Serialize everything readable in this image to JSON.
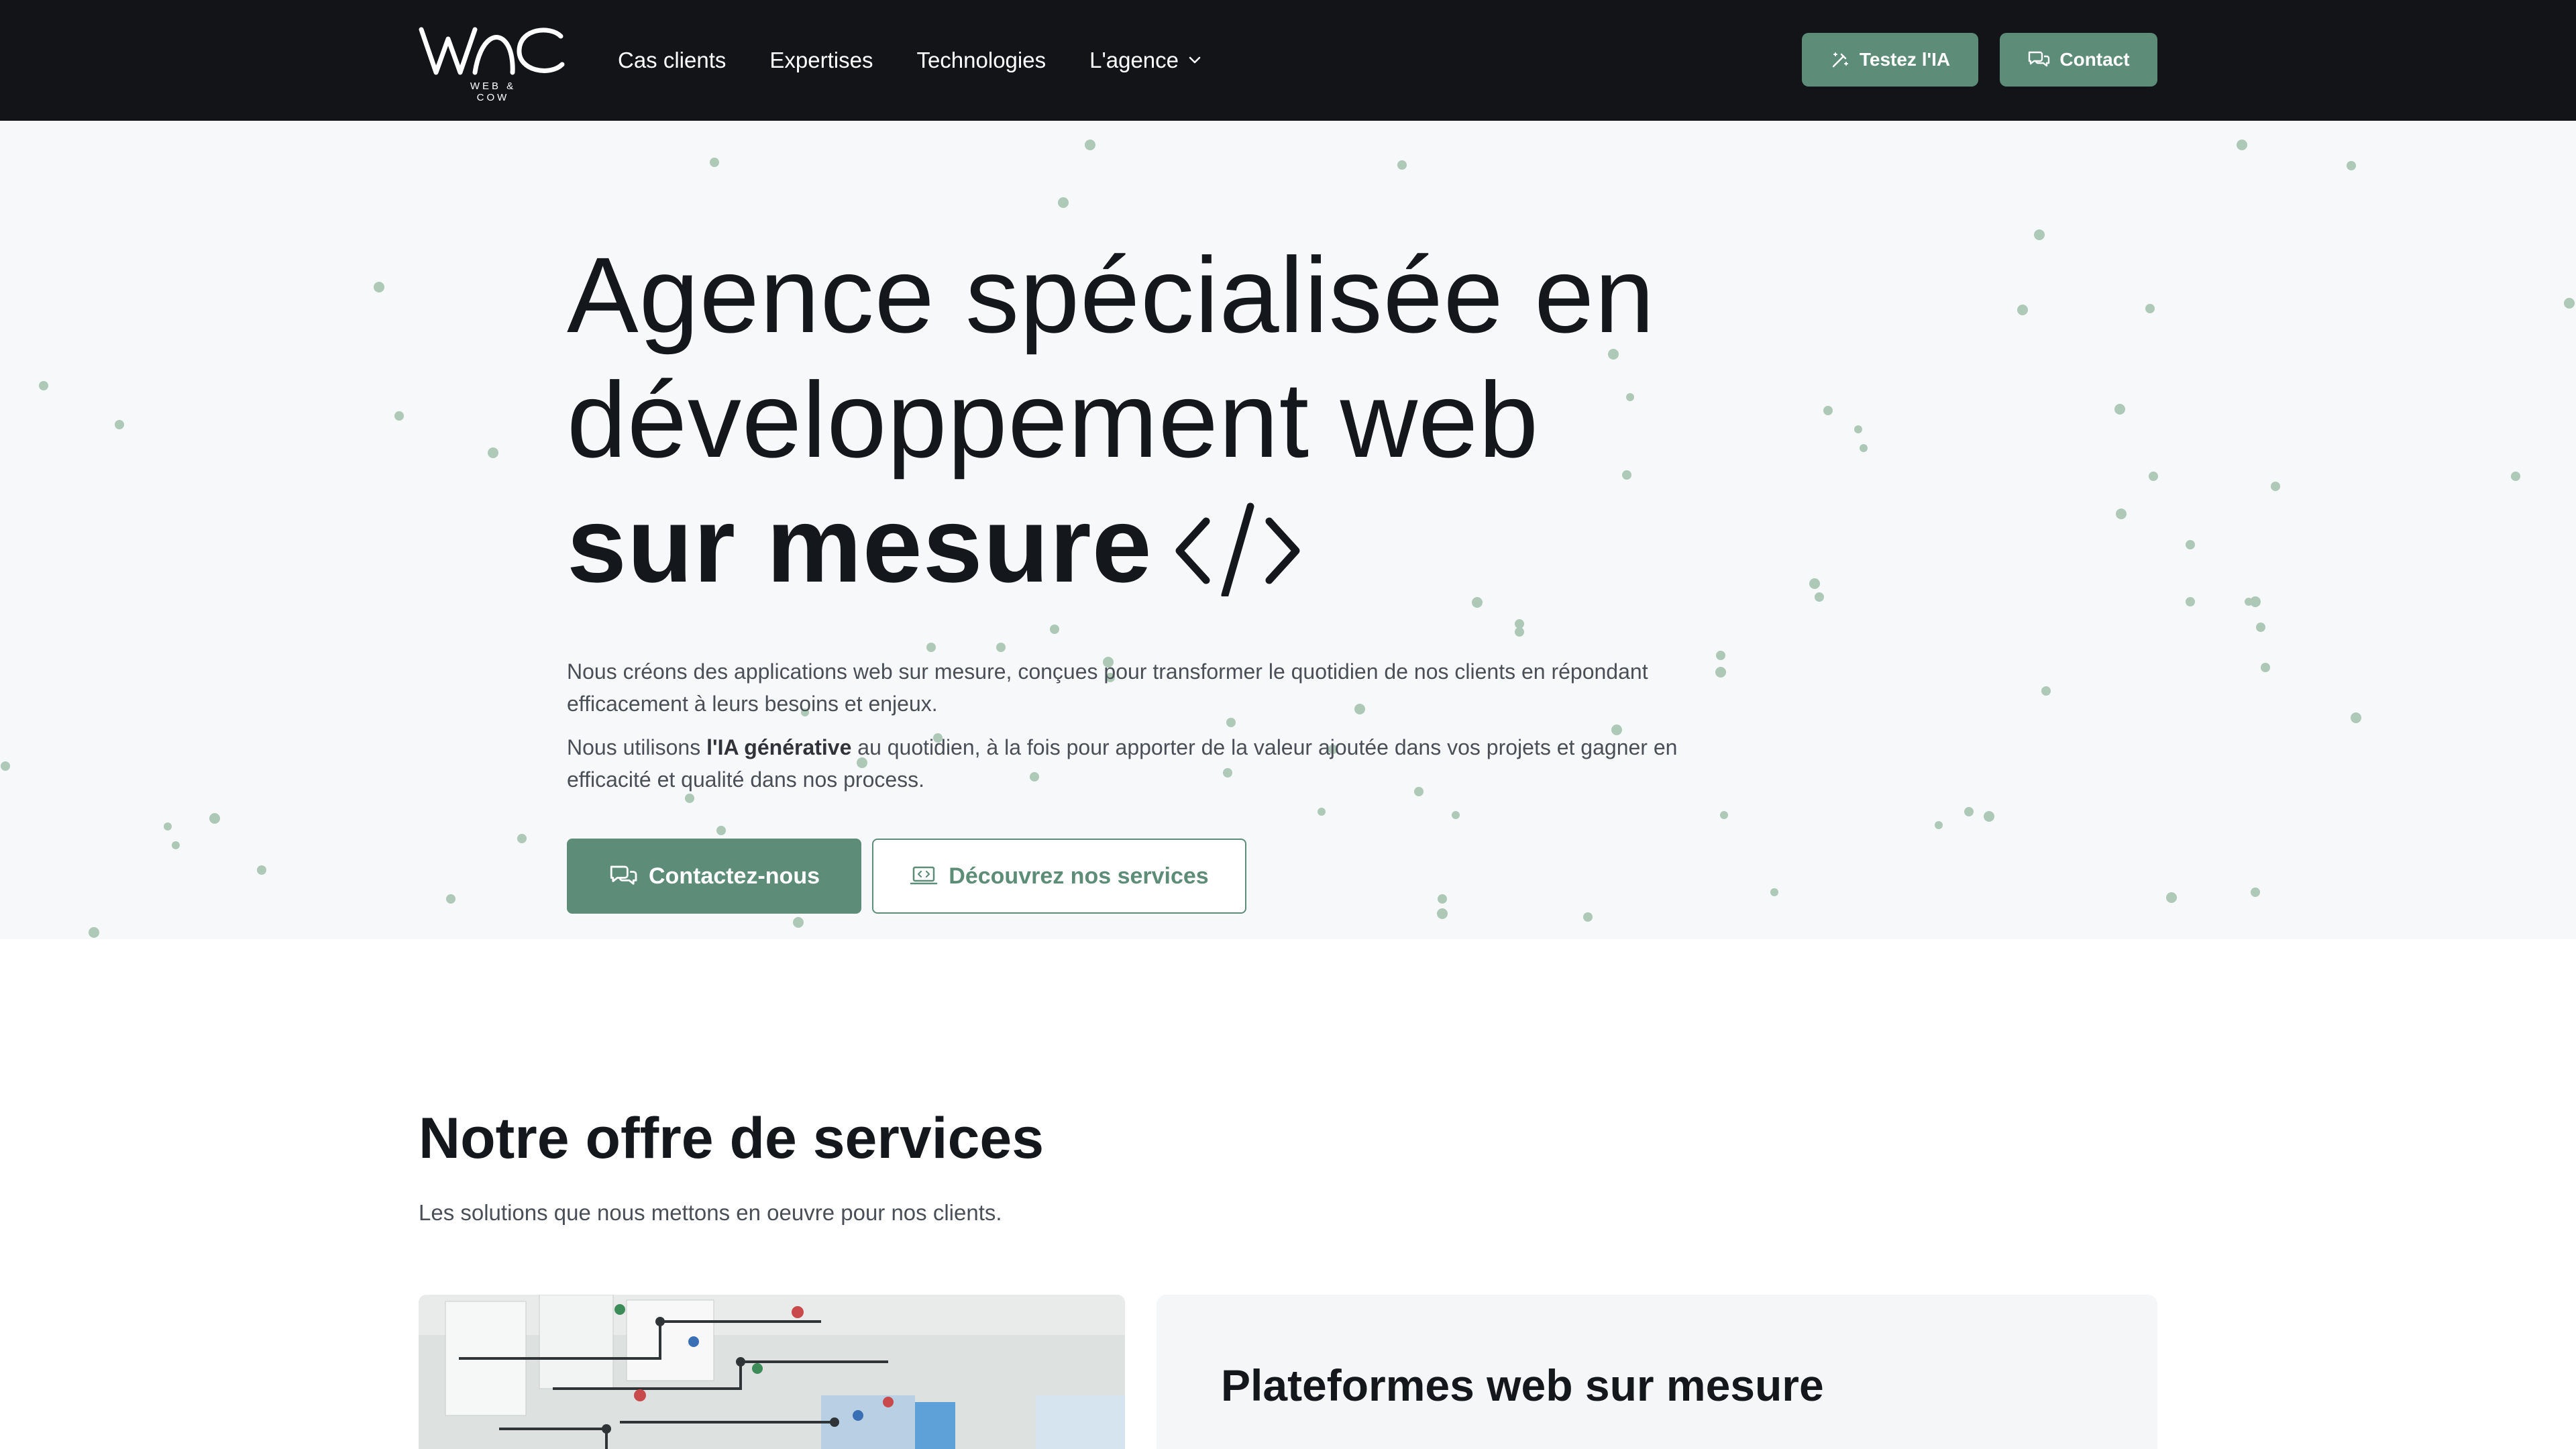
{
  "header": {
    "logo_text": "WAC",
    "logo_subtitle": "WEB & COW",
    "nav": [
      {
        "label": "Cas clients"
      },
      {
        "label": "Expertises"
      },
      {
        "label": "Technologies"
      },
      {
        "label": "L'agence"
      }
    ],
    "cta_ai": {
      "label": "Testez l'IA",
      "icon": "magic-wand-icon"
    },
    "cta_contact": {
      "label": "Contact",
      "icon": "chat-bubbles-icon"
    }
  },
  "hero": {
    "title_line1": "Agence spécialisée en",
    "title_line2": "développement web",
    "title_line3": "sur mesure",
    "title_icon": "code-brackets-icon",
    "paragraph1": "Nous créons des applications web sur mesure, conçues pour transformer le quotidien de nos clients en répondant efficacement à leurs besoins et enjeux.",
    "paragraph2_before": "Nous utilisons ",
    "paragraph2_bold": "l'IA générative",
    "paragraph2_after": " au quotidien, à la fois pour apporter de la valeur ajoutée dans vos projets et gagner en efficacité et qualité dans nos process.",
    "primary_button": {
      "label": "Contactez-nous",
      "icon": "chat-bubbles-icon"
    },
    "secondary_button": {
      "label": "Découvrez nos services",
      "icon": "laptop-code-icon"
    }
  },
  "services": {
    "title": "Notre offre de services",
    "subtitle": "Les solutions que nous mettons en oeuvre pour nos clients.",
    "first_card_title": "Plateformes web sur mesure"
  },
  "colors": {
    "header_bg": "#121418",
    "accent": "#5d8d78",
    "hero_bg": "#f7f8fa",
    "text": "#14171c"
  }
}
